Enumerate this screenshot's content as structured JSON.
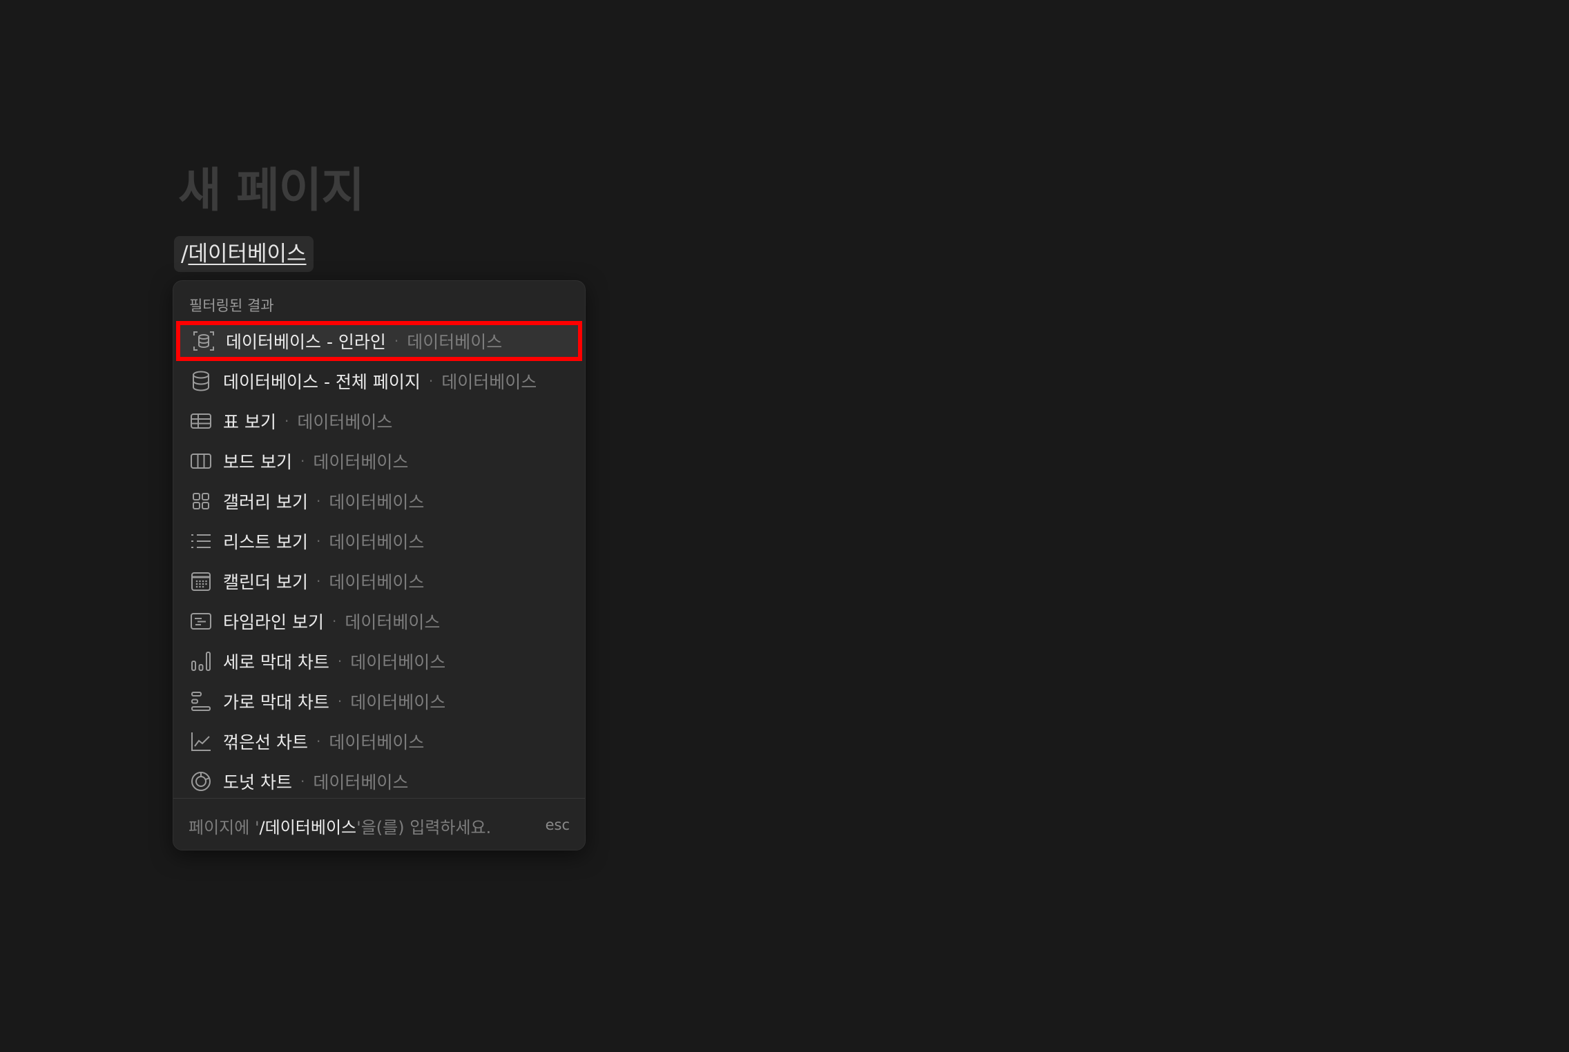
{
  "page": {
    "title": "새 페이지"
  },
  "editor": {
    "slash_prefix": "/",
    "slash_query": "데이터베이스"
  },
  "menu": {
    "header": "필터링된 결과",
    "items": [
      {
        "label": "데이터베이스 - 인라인",
        "category": "데이터베이스",
        "icon": "database-inline-icon",
        "selected": true
      },
      {
        "label": "데이터베이스 - 전체 페이지",
        "category": "데이터베이스",
        "icon": "database-icon"
      },
      {
        "label": "표 보기",
        "category": "데이터베이스",
        "icon": "table-icon"
      },
      {
        "label": "보드 보기",
        "category": "데이터베이스",
        "icon": "board-icon"
      },
      {
        "label": "갤러리 보기",
        "category": "데이터베이스",
        "icon": "gallery-icon"
      },
      {
        "label": "리스트 보기",
        "category": "데이터베이스",
        "icon": "list-icon"
      },
      {
        "label": "캘린더 보기",
        "category": "데이터베이스",
        "icon": "calendar-icon"
      },
      {
        "label": "타임라인 보기",
        "category": "데이터베이스",
        "icon": "timeline-icon"
      },
      {
        "label": "세로 막대 차트",
        "category": "데이터베이스",
        "icon": "vertical-bar-chart-icon"
      },
      {
        "label": "가로 막대 차트",
        "category": "데이터베이스",
        "icon": "horizontal-bar-chart-icon"
      },
      {
        "label": "꺾은선 차트",
        "category": "데이터베이스",
        "icon": "line-chart-icon"
      },
      {
        "label": "도넛 차트",
        "category": "데이터베이스",
        "icon": "donut-chart-icon"
      }
    ],
    "separator": "·",
    "footer": {
      "hint_before": "페이지에 '",
      "hint_command": "/데이터베이스",
      "hint_after": "'을(를) 입력하세요.",
      "esc_label": "esc"
    }
  },
  "colors": {
    "background": "#191919",
    "menu_background": "#252525",
    "selected_background": "#333333",
    "highlight_outline": "#ff0000"
  }
}
